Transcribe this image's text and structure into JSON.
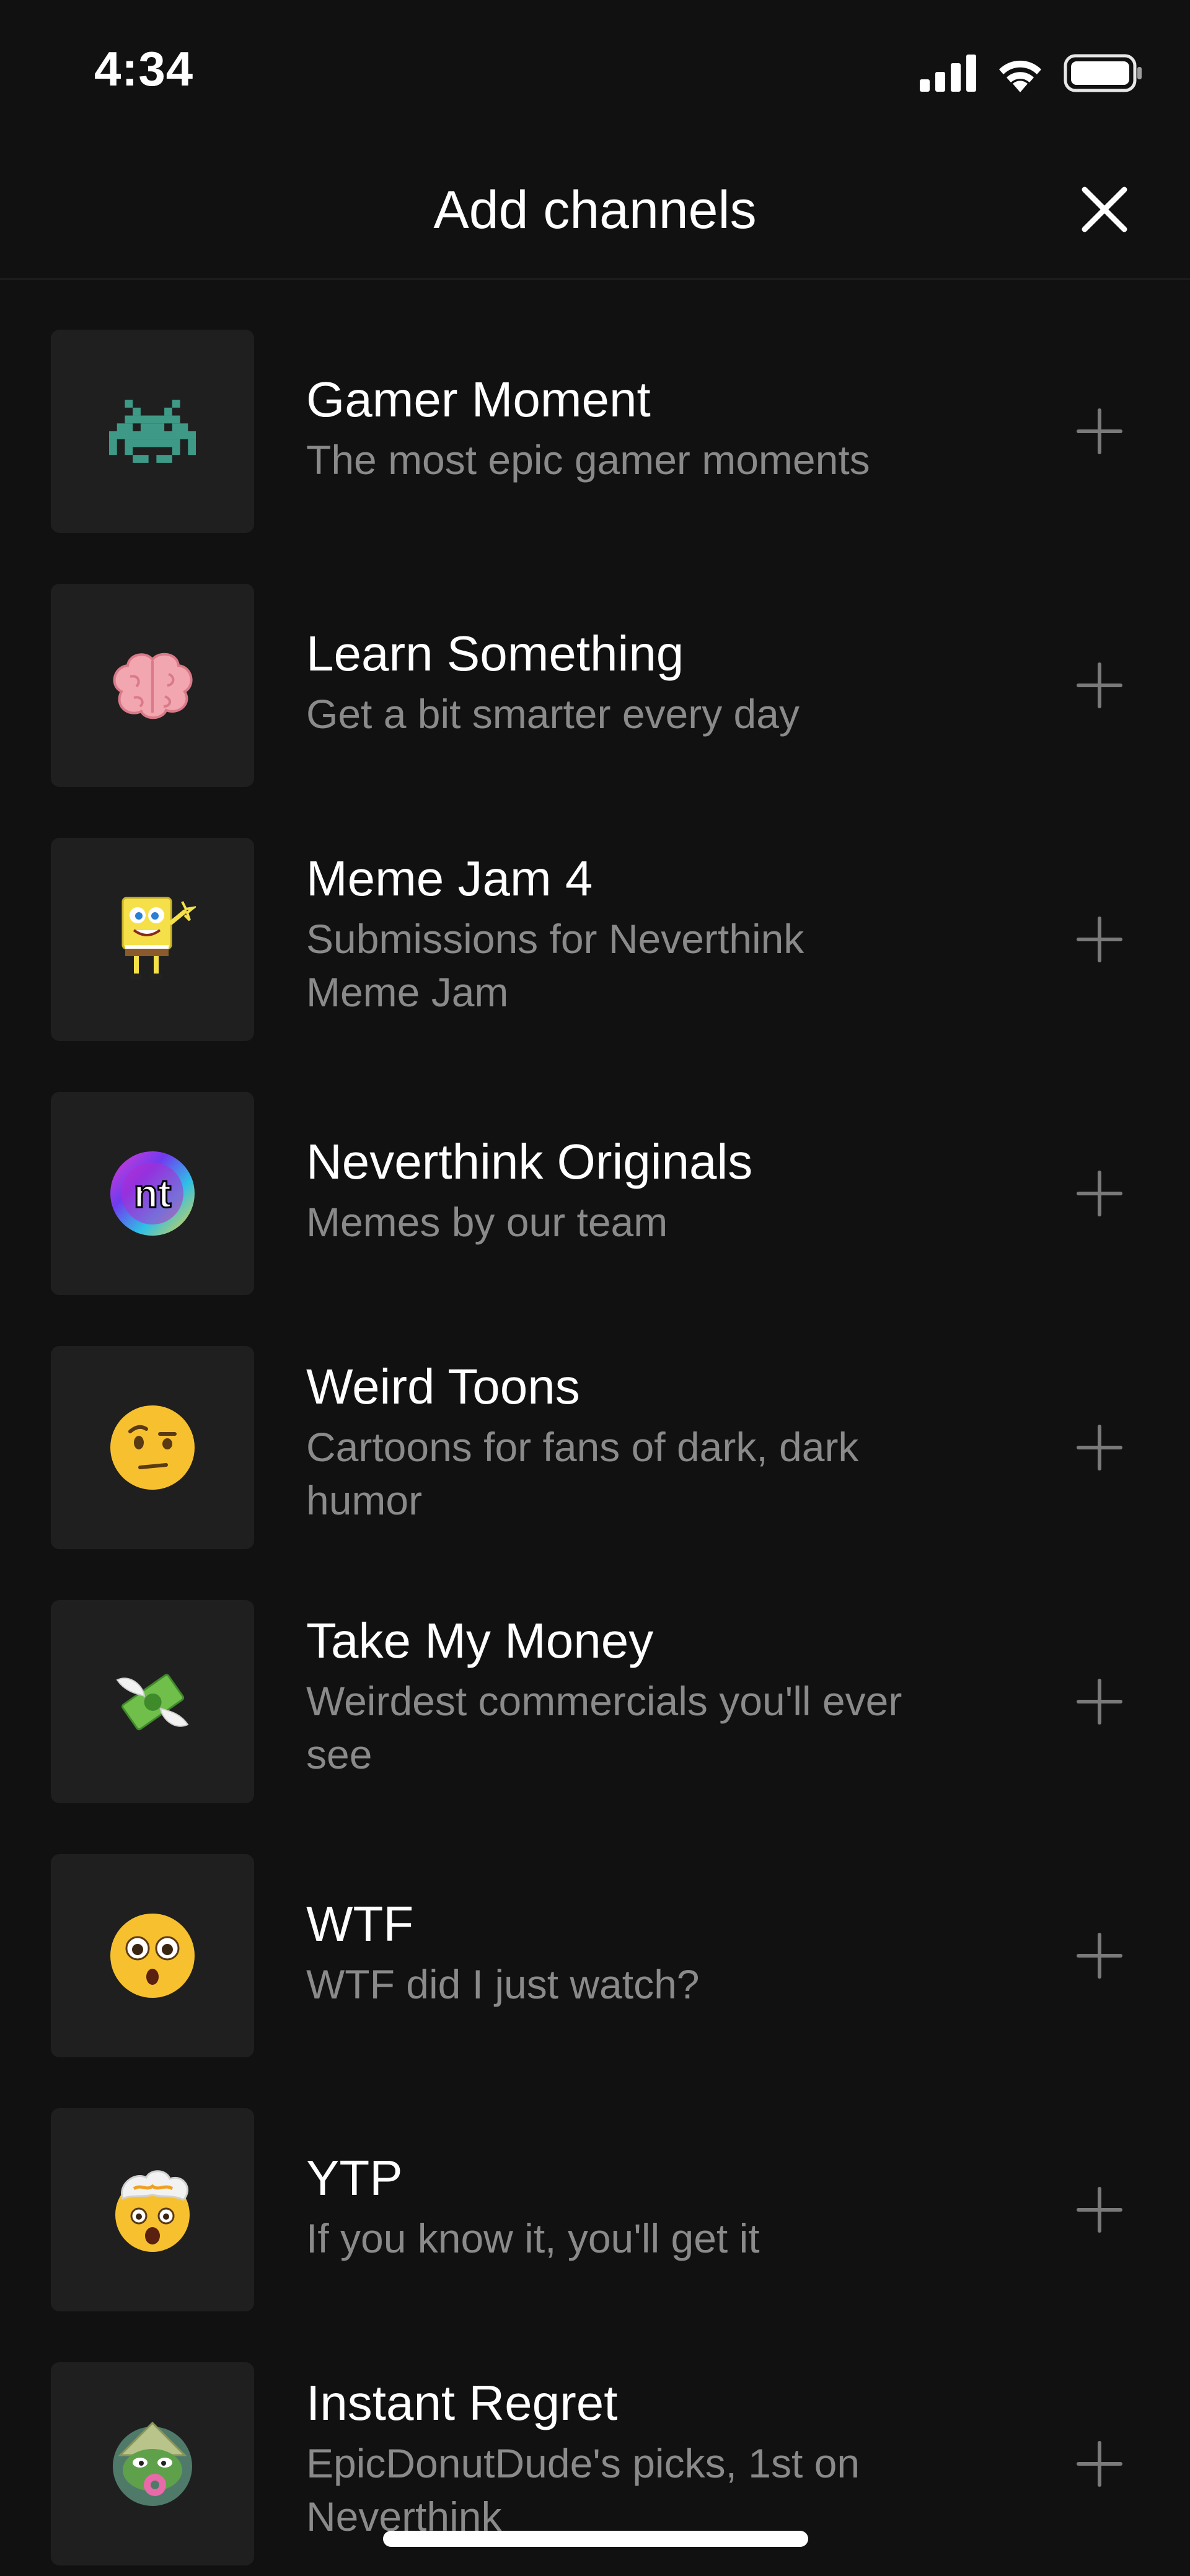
{
  "status_bar": {
    "time": "4:34"
  },
  "header": {
    "title": "Add channels"
  },
  "channels": [
    {
      "name": "Gamer Moment",
      "description": "The most epic gamer moments",
      "icon": "space-invader-icon"
    },
    {
      "name": "Learn Something",
      "description": "Get a bit smarter every day",
      "icon": "brain-icon"
    },
    {
      "name": "Meme Jam 4",
      "description": "Submissions for Neverthink Meme Jam",
      "icon": "sponge-character-icon"
    },
    {
      "name": "Neverthink Originals",
      "description": "Memes by our team",
      "icon": "neverthink-logo-icon",
      "logo_text": "nt"
    },
    {
      "name": "Weird Toons",
      "description": "Cartoons for fans of dark, dark humor",
      "icon": "raised-eyebrow-face-icon"
    },
    {
      "name": "Take My Money",
      "description": "Weirdest commercials you'll ever see",
      "icon": "money-with-wings-icon"
    },
    {
      "name": "WTF",
      "description": "WTF did I just watch?",
      "icon": "flushed-face-icon"
    },
    {
      "name": "YTP",
      "description": "If you know it, you'll get it",
      "icon": "exploding-head-icon"
    },
    {
      "name": "Instant Regret",
      "description": "EpicDonutDude's picks, 1st on Neverthink",
      "icon": "frog-with-donut-icon"
    }
  ],
  "colors": {
    "background": "#111111",
    "tile": "#1f1f1f",
    "primary_text": "#ffffff",
    "secondary_text": "#8a8a8a",
    "plus": "#7a7a7a"
  }
}
